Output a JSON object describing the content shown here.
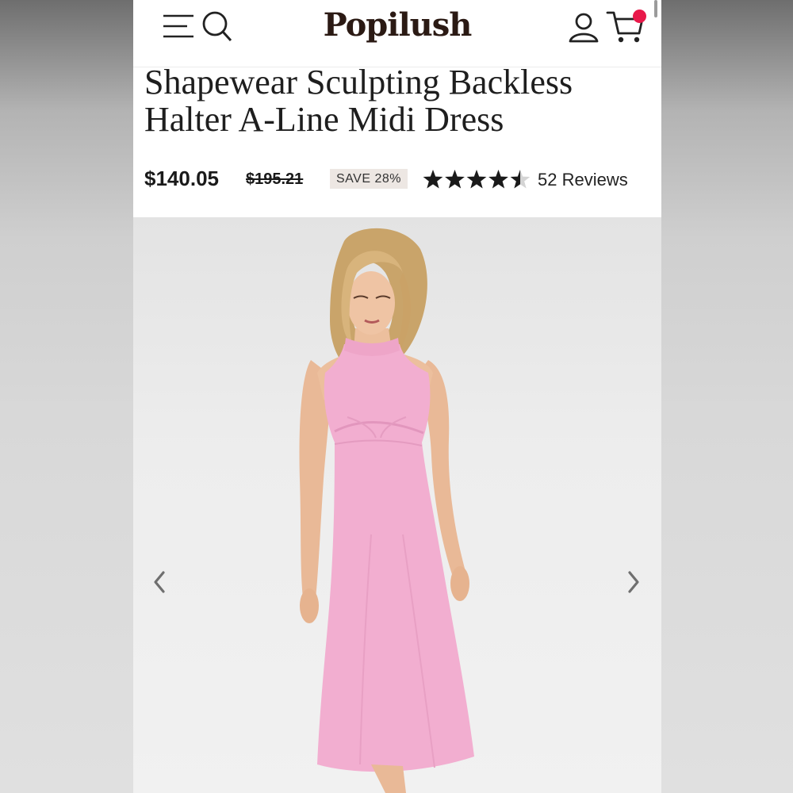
{
  "header": {
    "logo": "Popilush",
    "icons": {
      "menu": "menu-icon",
      "search": "search-icon",
      "account": "account-icon",
      "cart": "cart-icon"
    },
    "cart_badge_color": "#e8194a"
  },
  "product": {
    "title_line1": "Shapewear Sculpting Backless",
    "title_line2": "Halter A-Line Midi Dress",
    "price": "$140.05",
    "original_price": "$195.21",
    "save_label": "SAVE 28%",
    "rating": 4.5,
    "rating_max": 5,
    "reviews_label": "52 Reviews"
  },
  "gallery": {
    "image_subject": "model wearing pink halter midi dress",
    "dress_color": "#f2aed0",
    "prev_icon": "chevron-left-icon",
    "next_icon": "chevron-right-icon"
  }
}
